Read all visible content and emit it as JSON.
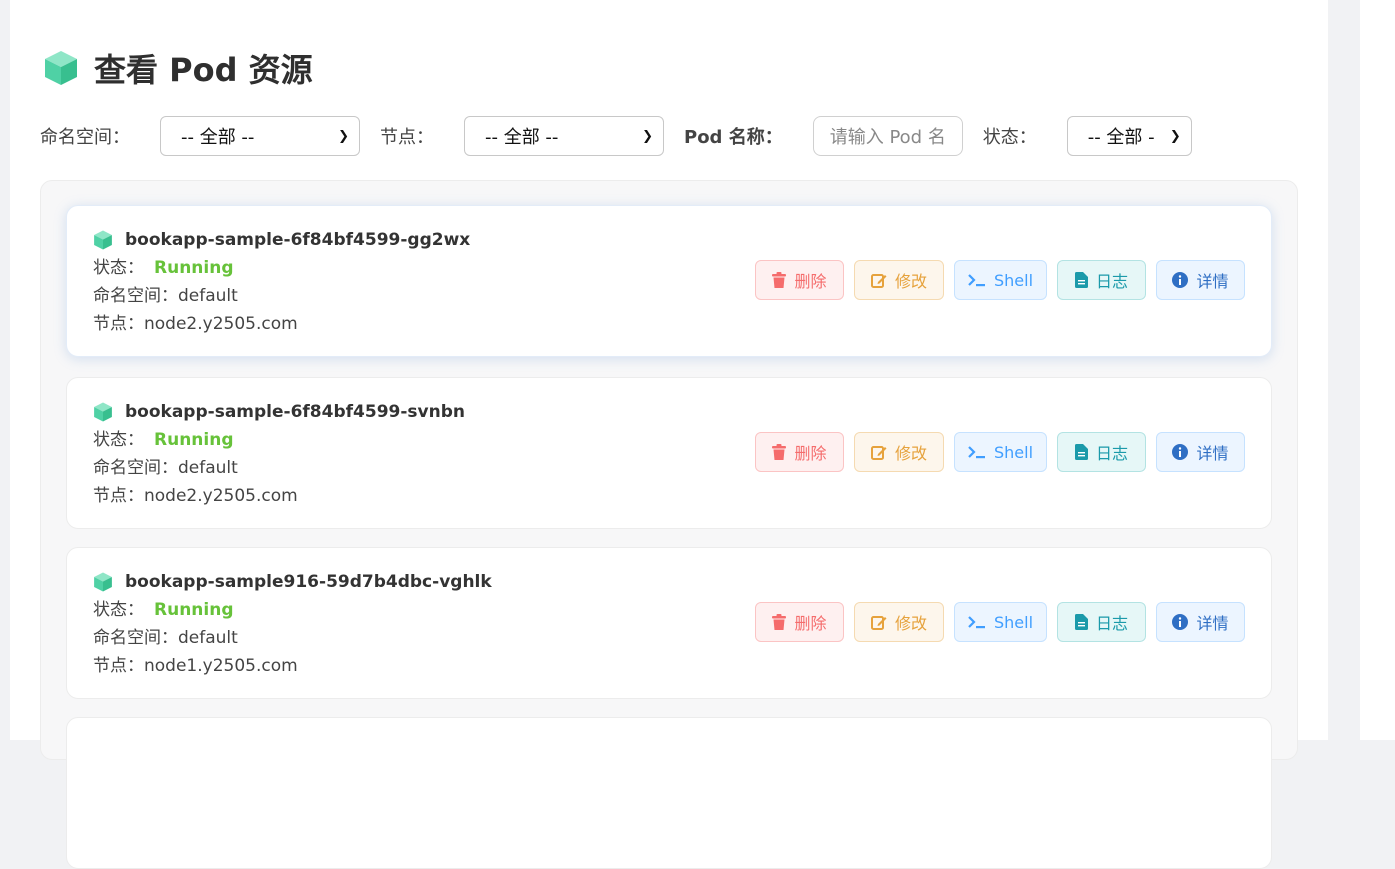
{
  "page": {
    "title": "查看 Pod 资源"
  },
  "filters": {
    "namespace": {
      "label": "命名空间：",
      "value": "-- 全部 --"
    },
    "node": {
      "label": "节点：",
      "value": "-- 全部 --"
    },
    "pod_name": {
      "label": "Pod 名称：",
      "placeholder": "请输入 Pod 名"
    },
    "status": {
      "label": "状态：",
      "value": "-- 全部 -"
    }
  },
  "labels": {
    "status": "状态：",
    "namespace": "命名空间：",
    "node": "节点："
  },
  "actions": {
    "delete": "删除",
    "edit": "修改",
    "shell": "Shell",
    "logs": "日志",
    "details": "详情"
  },
  "pods": [
    {
      "name": "bookapp-sample-6f84bf4599-gg2wx",
      "status": "Running",
      "namespace": "default",
      "node": "node2.y2505.com"
    },
    {
      "name": "bookapp-sample-6f84bf4599-svnbn",
      "status": "Running",
      "namespace": "default",
      "node": "node2.y2505.com"
    },
    {
      "name": "bookapp-sample916-59d7b4dbc-vghlk",
      "status": "Running",
      "namespace": "default",
      "node": "node1.y2505.com"
    }
  ],
  "icons": {
    "pod": "cube-icon",
    "delete": "trash-icon",
    "edit": "edit-icon",
    "shell": "terminal-icon",
    "logs": "file-icon",
    "details": "info-icon",
    "dropdown": "chevron-down-icon"
  },
  "colors": {
    "running": "#67c23a",
    "accent": "#4fd1a5"
  }
}
